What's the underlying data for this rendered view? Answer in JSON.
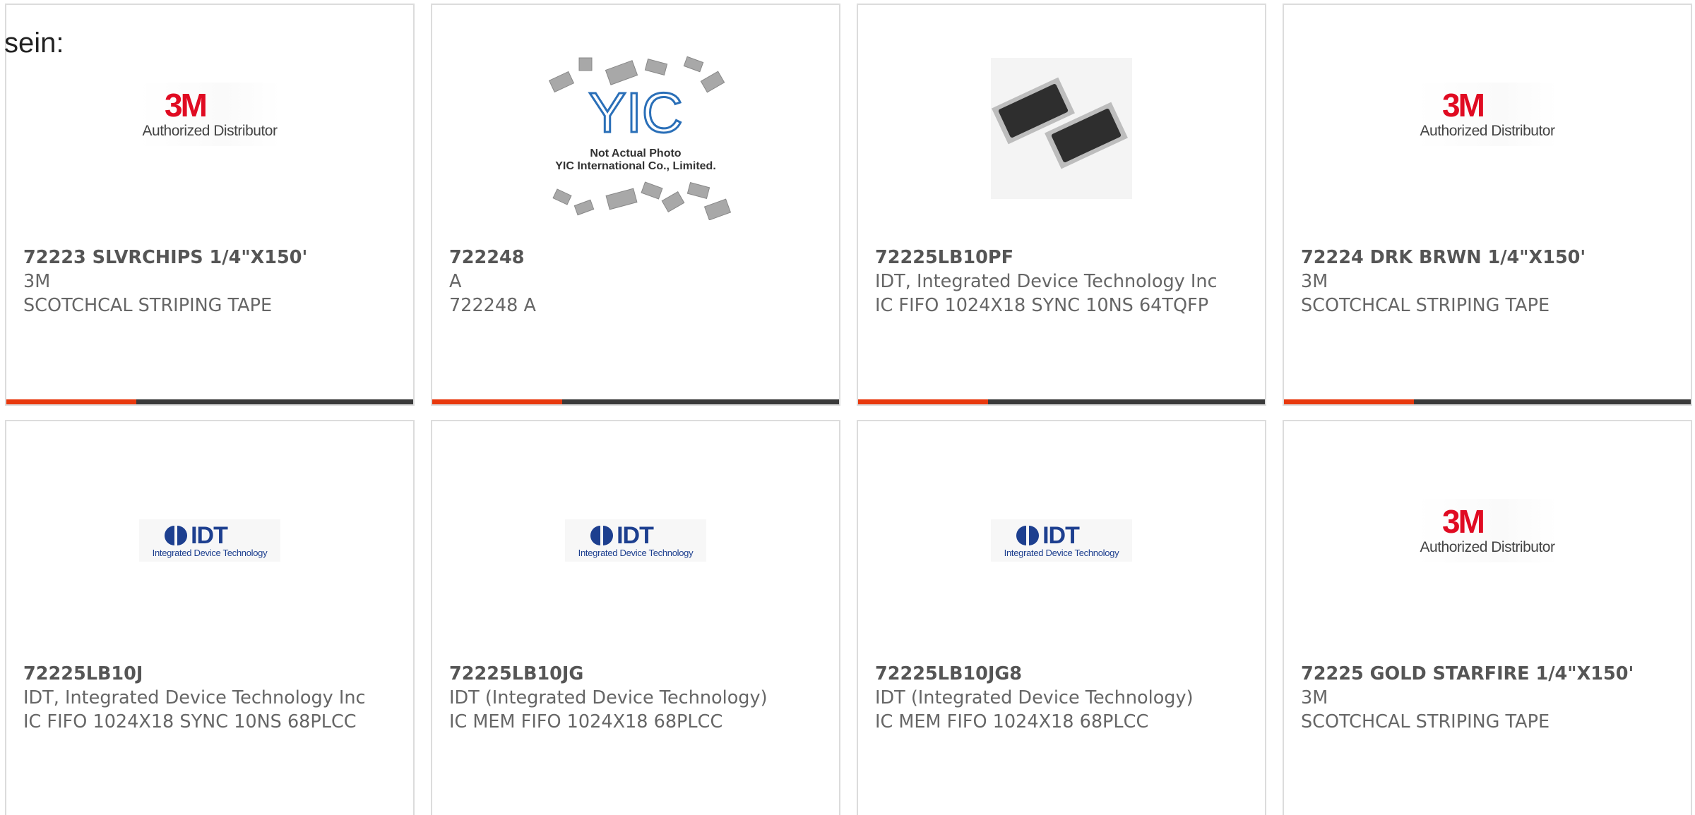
{
  "intro": {
    "text": "sein:"
  },
  "brands": {
    "3m": {
      "mark": "3M",
      "subtitle": "Authorized Distributor",
      "color": "#e00b22"
    },
    "idt": {
      "mark": "IDT",
      "subtitle": "Integrated Device Technology",
      "color": "#1d3f8f"
    },
    "yic": {
      "mark": "YIC",
      "line1": "Not Actual Photo",
      "line2": "YIC International Co., Limited."
    }
  },
  "colors": {
    "accent": "#e8380d",
    "bar": "#3a3a3a"
  },
  "products": [
    {
      "part": "72223 SLVRCHIPS 1/4\"X150'",
      "maker": "3M",
      "desc": "SCOTCHCAL STRIPING TAPE",
      "image": "3m-logo"
    },
    {
      "part": "722248",
      "maker": "A",
      "desc": "722248 A",
      "image": "yic-placeholder"
    },
    {
      "part": "72225LB10PF",
      "maker": "IDT, Integrated Device Technology Inc",
      "desc": "IC FIFO 1024X18 SYNC 10NS 64TQFP",
      "image": "chip-photo"
    },
    {
      "part": "72224 DRK BRWN 1/4\"X150'",
      "maker": "3M",
      "desc": "SCOTCHCAL STRIPING TAPE",
      "image": "3m-logo"
    },
    {
      "part": "72225LB10J",
      "maker": "IDT, Integrated Device Technology Inc",
      "desc": "IC FIFO 1024X18 SYNC 10NS 68PLCC",
      "image": "idt-logo"
    },
    {
      "part": "72225LB10JG",
      "maker": "IDT (Integrated Device Technology)",
      "desc": "IC MEM FIFO 1024X18 68PLCC",
      "image": "idt-logo"
    },
    {
      "part": "72225LB10JG8",
      "maker": "IDT (Integrated Device Technology)",
      "desc": "IC MEM FIFO 1024X18 68PLCC",
      "image": "idt-logo"
    },
    {
      "part": "72225 GOLD STARFIRE 1/4\"X150'",
      "maker": "3M",
      "desc": "SCOTCHCAL STRIPING TAPE",
      "image": "3m-logo"
    }
  ]
}
